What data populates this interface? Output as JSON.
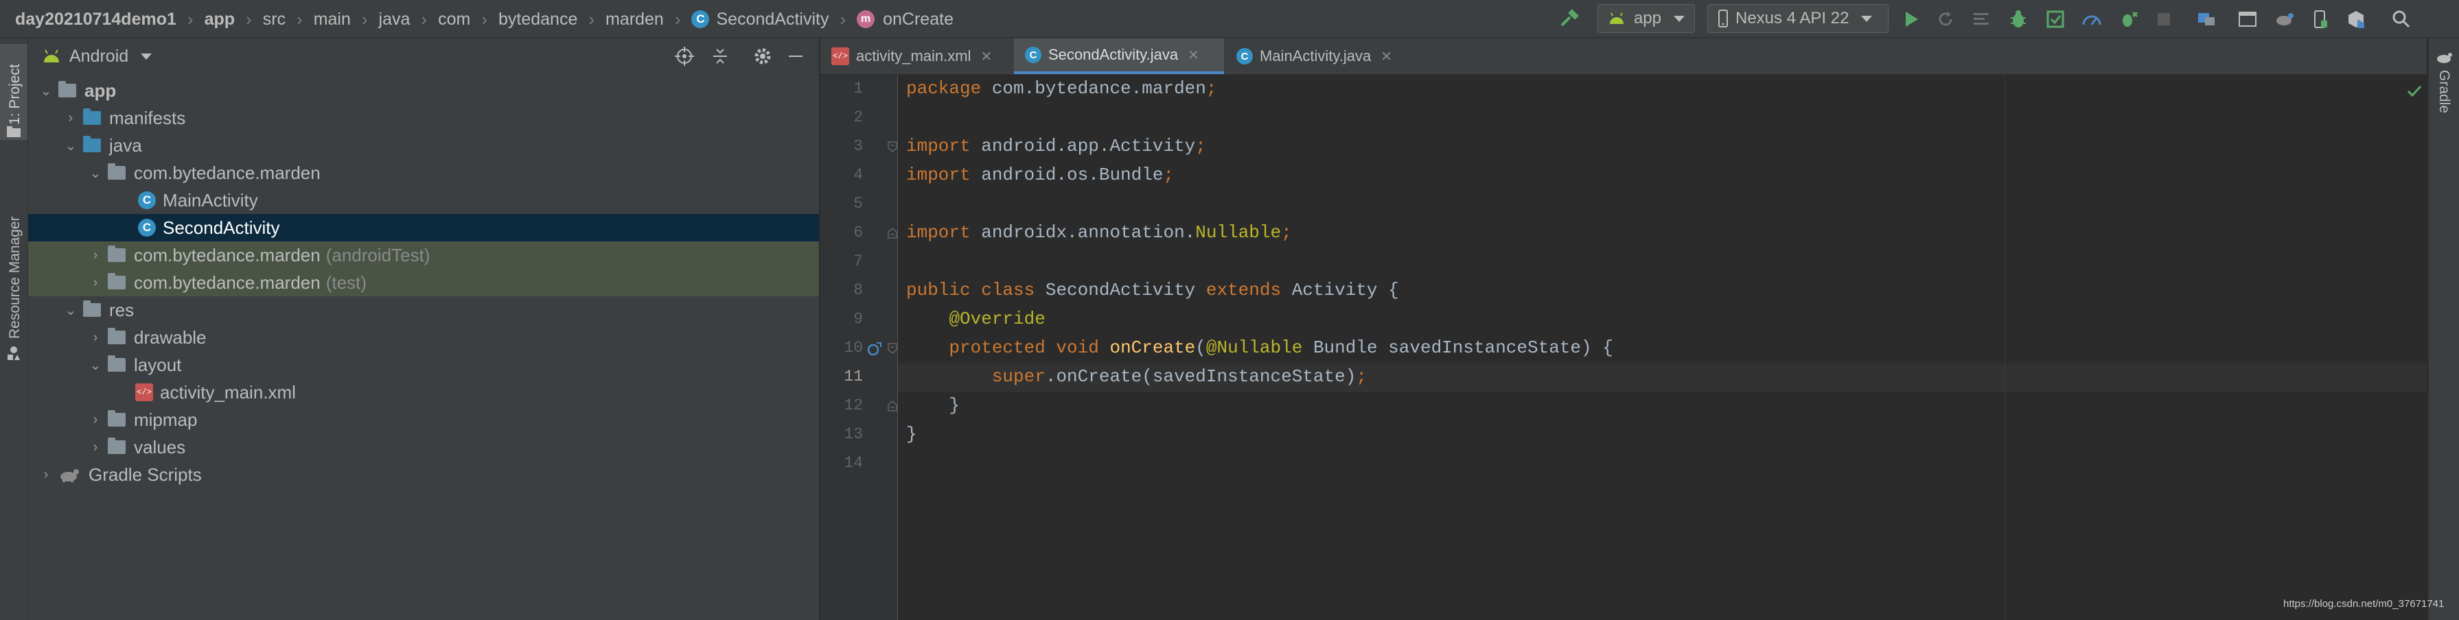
{
  "breadcrumbs": [
    {
      "label": "day20210714demo1",
      "bold": true
    },
    {
      "label": "app",
      "bold": true
    },
    {
      "label": "src"
    },
    {
      "label": "main"
    },
    {
      "label": "java"
    },
    {
      "label": "com"
    },
    {
      "label": "bytedance"
    },
    {
      "label": "marden"
    },
    {
      "label": "SecondActivity",
      "icon": "class-icon"
    },
    {
      "label": "onCreate",
      "icon": "method-icon"
    }
  ],
  "toolbar": {
    "run_config": "app",
    "device": "Nexus 4 API 22"
  },
  "left_strip": {
    "project_tab": "1: Project",
    "resource_tab": "Resource Manager"
  },
  "right_strip": {
    "gradle_tab": "Gradle"
  },
  "project_panel": {
    "view_mode": "Android"
  },
  "tree": [
    {
      "label": "app",
      "bold": true
    },
    {
      "label": "manifests"
    },
    {
      "label": "java"
    },
    {
      "label": "com.bytedance.marden"
    },
    {
      "label": "MainActivity"
    },
    {
      "label": "SecondActivity"
    },
    {
      "label": "com.bytedance.marden",
      "suffix": "(androidTest)"
    },
    {
      "label": "com.bytedance.marden",
      "suffix": "(test)"
    },
    {
      "label": "res"
    },
    {
      "label": "drawable"
    },
    {
      "label": "layout"
    },
    {
      "label": "activity_main.xml"
    },
    {
      "label": "mipmap"
    },
    {
      "label": "values"
    },
    {
      "label": "Gradle Scripts"
    }
  ],
  "tabs": [
    {
      "label": "activity_main.xml"
    },
    {
      "label": "SecondActivity.java",
      "active": true
    },
    {
      "label": "MainActivity.java"
    }
  ],
  "editor": {
    "line_numbers": [
      "1",
      "2",
      "3",
      "4",
      "5",
      "6",
      "7",
      "8",
      "9",
      "10",
      "11",
      "12",
      "13",
      "14"
    ],
    "current_line": "11",
    "code": {
      "l1_kw": "package",
      "l1_rest": " com.bytedance.marden",
      "l1_semi": ";",
      "l3_kw": "import",
      "l3_rest": " android.app.Activity",
      "l3_semi": ";",
      "l4_kw": "import",
      "l4_rest": " android.os.Bundle",
      "l4_semi": ";",
      "l6_kw": "import",
      "l6_rest": " androidx.annotation.",
      "l6_ann": "Nullable",
      "l6_semi": ";",
      "l8_kw1": "public class",
      "l8_cls": " SecondActivity ",
      "l8_kw2": "extends",
      "l8_rest": " Activity {",
      "l9_ann": "    @Override",
      "l10_kw": "    protected void",
      "l10_fn": " onCreate",
      "l10_p1": "(",
      "l10_ann": "@Nullable",
      "l10_rest": " Bundle savedInstanceState) {",
      "l11_kw": "        super",
      "l11_rest": ".onCreate(savedInstanceState)",
      "l11_semi": ";",
      "l12": "    }",
      "l13": "}"
    }
  },
  "watermark": "https://blog.csdn.net/m0_37671741",
  "colors": {
    "keyword": "#cc7832",
    "annotation": "#bbb529",
    "method": "#ffc66d",
    "selection": "#0d293e",
    "test_highlight": "#4a5445",
    "run_green": "#59a869"
  }
}
